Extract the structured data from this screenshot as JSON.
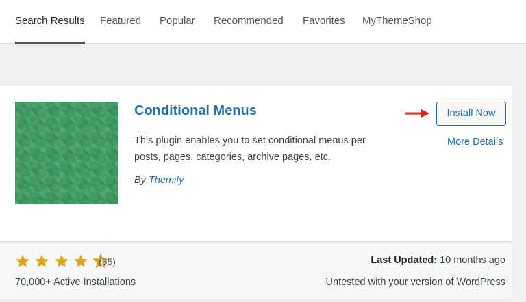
{
  "tabs": [
    {
      "label": "Search Results"
    },
    {
      "label": "Featured"
    },
    {
      "label": "Popular"
    },
    {
      "label": "Recommended"
    },
    {
      "label": "Favorites"
    },
    {
      "label": "MyThemeShop"
    }
  ],
  "active_tab": "Search Results",
  "plugin": {
    "name": "Conditional Menus",
    "description": "This plugin enables you to set conditional menus per posts, pages, categories, archive pages, etc.",
    "author_prefix": "By",
    "author": "Themify",
    "install_label": "Install Now",
    "more_details_label": "More Details",
    "rating_stars": 4.5,
    "rating_count": "(55)",
    "active_installs": "70,000+ Active Installations",
    "last_updated_label": "Last Updated:",
    "last_updated_value": "10 months ago",
    "compatibility": "Untested with your version of WordPress"
  },
  "colors": {
    "link": "#2271b1",
    "star": "#dba617",
    "arrow": "#e11d1d",
    "thumb": "#3e9a63"
  }
}
